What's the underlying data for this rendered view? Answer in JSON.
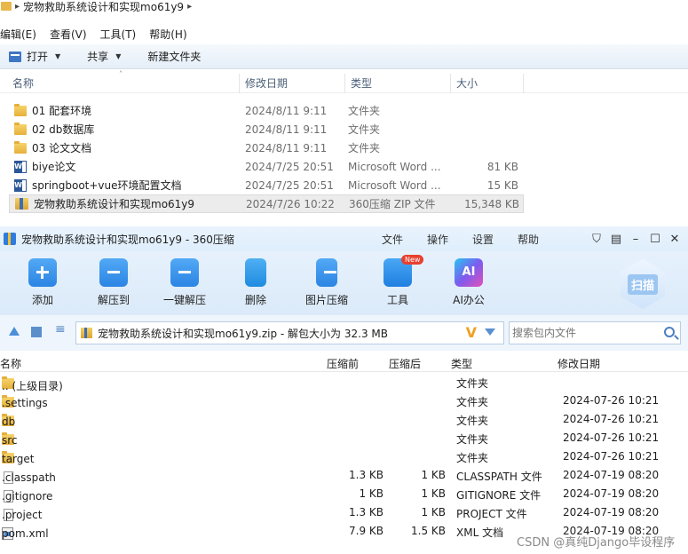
{
  "explorer": {
    "path": "宠物救助系统设计和实现mo61y9",
    "menu": [
      "编辑(E)",
      "查看(V)",
      "工具(T)",
      "帮助(H)"
    ],
    "toolbar": {
      "open": "打开",
      "share": "共享",
      "new_folder": "新建文件夹"
    },
    "columns": {
      "name": "名称",
      "date": "修改日期",
      "type": "类型",
      "size": "大小"
    },
    "rows": [
      {
        "name": "01 配套环境",
        "date": "2024/8/11 9:11",
        "type": "文件夹",
        "size": "",
        "icon": "folder-icon"
      },
      {
        "name": "02 db数据库",
        "date": "2024/8/11 9:11",
        "type": "文件夹",
        "size": "",
        "icon": "folder-icon"
      },
      {
        "name": "03 论文文档",
        "date": "2024/8/11 9:11",
        "type": "文件夹",
        "size": "",
        "icon": "folder-icon"
      },
      {
        "name": "biye论文",
        "date": "2024/7/25 20:51",
        "type": "Microsoft Word ...",
        "size": "81 KB",
        "icon": "word-icon"
      },
      {
        "name": "springboot+vue环境配置文档",
        "date": "2024/7/25 20:51",
        "type": "Microsoft Word ...",
        "size": "15 KB",
        "icon": "word-icon"
      },
      {
        "name": "宠物救助系统设计和实现mo61y9",
        "date": "2024/7/26 10:22",
        "type": "360压缩 ZIP 文件",
        "size": "15,348 KB",
        "icon": "zip-icon"
      }
    ]
  },
  "zip": {
    "title": "宠物救助系统设计和实现mo61y9 - 360压缩",
    "menus": [
      "文件",
      "操作",
      "设置",
      "帮助"
    ],
    "toolbar": {
      "add": "添加",
      "extract_to": "解压到",
      "one_click": "一键解压",
      "delete": "删除",
      "image_compress": "图片压缩",
      "tools": "工具",
      "ai_office": "AI办公",
      "new_badge": "New",
      "ai_icon_text": "AI",
      "scan": "扫描"
    },
    "path": "宠物救助系统设计和实现mo61y9.zip - 解包大小为 32.3 MB",
    "v_mark": "V",
    "search_placeholder": "搜索包内文件",
    "columns": {
      "name": "名称",
      "compressed": "压缩前",
      "original": "压缩后",
      "type": "类型",
      "date": "修改日期"
    },
    "rows": [
      {
        "name": ".. (上级目录)",
        "csize": "",
        "osize": "",
        "type": "文件夹",
        "date": "",
        "icon": "folder-icon"
      },
      {
        "name": ".settings",
        "csize": "",
        "osize": "",
        "type": "文件夹",
        "date": "2024-07-26 10:21",
        "icon": "folder-icon"
      },
      {
        "name": "db",
        "csize": "",
        "osize": "",
        "type": "文件夹",
        "date": "2024-07-26 10:21",
        "icon": "folder-icon"
      },
      {
        "name": "src",
        "csize": "",
        "osize": "",
        "type": "文件夹",
        "date": "2024-07-26 10:21",
        "icon": "folder-icon"
      },
      {
        "name": "target",
        "csize": "",
        "osize": "",
        "type": "文件夹",
        "date": "2024-07-26 10:21",
        "icon": "folder-icon"
      },
      {
        "name": ".classpath",
        "csize": "1.3 KB",
        "osize": "1 KB",
        "type": "CLASSPATH 文件",
        "date": "2024-07-19 08:20",
        "icon": "file-icon"
      },
      {
        "name": ".gitignore",
        "csize": "1 KB",
        "osize": "1 KB",
        "type": "GITIGNORE 文件",
        "date": "2024-07-19 08:20",
        "icon": "file-icon"
      },
      {
        "name": ".project",
        "csize": "1.3 KB",
        "osize": "1 KB",
        "type": "PROJECT 文件",
        "date": "2024-07-19 08:20",
        "icon": "file-icon"
      },
      {
        "name": "pom.xml",
        "csize": "7.9 KB",
        "osize": "1.5 KB",
        "type": "XML 文档",
        "date": "2024-07-19 08:20",
        "icon": "xml-icon"
      }
    ]
  },
  "watermark": "CSDN @真纯Django毕设程序"
}
